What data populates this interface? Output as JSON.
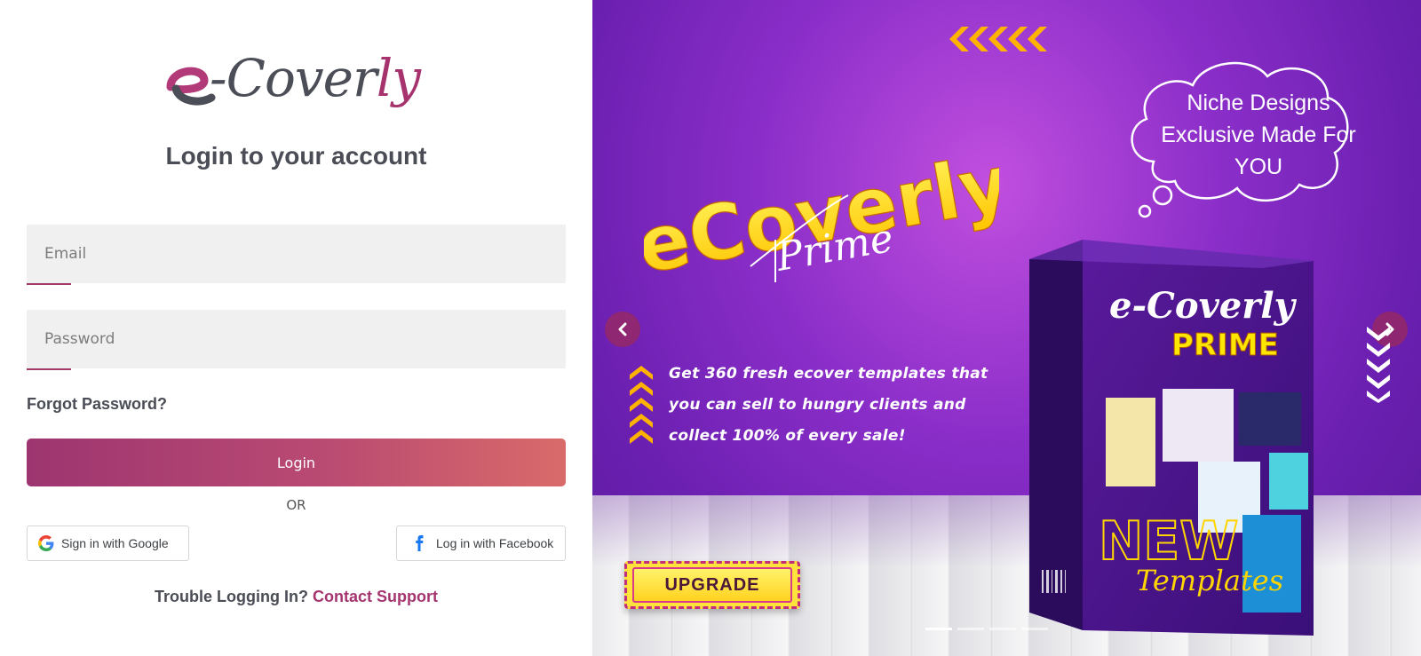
{
  "brand": {
    "logo_main": "-Cover",
    "logo_accent": "ly"
  },
  "login_form": {
    "title": "Login to your account",
    "email_placeholder": "Email",
    "password_placeholder": "Password",
    "forgot_password": "Forgot Password?",
    "login_label": "Login",
    "or_label": "OR",
    "google_label": "Sign in with Google",
    "facebook_label": "Log in with Facebook",
    "trouble_text": "Trouble Logging In?",
    "support_link": "Contact Support"
  },
  "banner": {
    "headline": "eCoverly",
    "headline_script": "Prime",
    "cloud_line1": "Niche Designs",
    "cloud_line2": "Exclusive Made For",
    "cloud_line3": "YOU",
    "tagline_line1": "Get 360 fresh ecover templates that",
    "tagline_line2": "you can sell to hungry clients and",
    "tagline_line3": "collect 100% of every sale!",
    "upgrade_label": "UPGRADE",
    "product_brand": "e-Coverly",
    "product_subtitle": "PRIME",
    "product_new": "NEW",
    "product_templates": "Templates"
  },
  "slider": {
    "slide_count": 4,
    "active_index": 0
  },
  "colors": {
    "accent": "#a4356f",
    "button_gradient_start": "#9d3570",
    "button_gradient_end": "#d96a6a",
    "banner_purple": "#7a27c0",
    "headline_yellow": "#ffe600"
  },
  "icons": {
    "google": "google-g-icon",
    "facebook": "facebook-f-icon",
    "prev": "chevron-left-icon",
    "next": "chevron-right-icon"
  }
}
